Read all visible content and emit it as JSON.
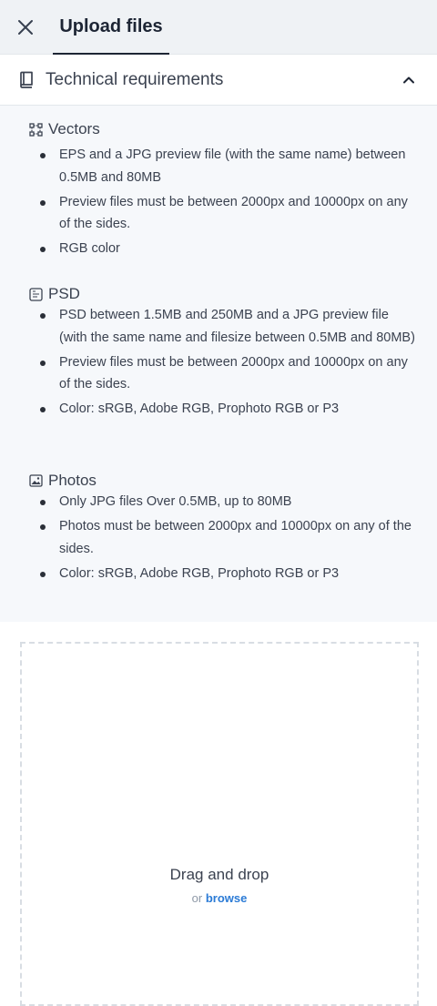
{
  "header": {
    "close_icon": "close-icon",
    "tab_label": "Upload files"
  },
  "requirements": {
    "title": "Technical requirements",
    "expanded": true,
    "sections": [
      {
        "title": "Vectors",
        "icon": "vector-icon",
        "items": [
          "EPS and a JPG preview file (with the same name) between 0.5MB and 80MB",
          "Preview files must be between 2000px and 10000px on any of the sides.",
          "RGB color"
        ]
      },
      {
        "title": "PSD",
        "icon": "psd-icon",
        "items": [
          "PSD between 1.5MB and 250MB and a JPG preview file (with the same name and filesize between 0.5MB and 80MB)",
          "Preview files must be between 2000px and 10000px on any of the sides.",
          "Color: sRGB, Adobe RGB, Prophoto RGB or P3"
        ]
      },
      {
        "title": "Photos",
        "icon": "image-icon",
        "items": [
          "Only JPG files Over 0.5MB, up to 80MB",
          "Photos must be between 2000px and 10000px on any of the sides.",
          "Color: sRGB, Adobe RGB, Prophoto RGB or P3"
        ]
      }
    ]
  },
  "dropzone": {
    "title": "Drag and drop",
    "or_text": "or",
    "browse_label": "browse"
  },
  "colors": {
    "topbar_bg": "#eff2f5",
    "requirements_bg": "#f6f8fb",
    "link": "#2b7bd6",
    "text": "#3b4250"
  }
}
